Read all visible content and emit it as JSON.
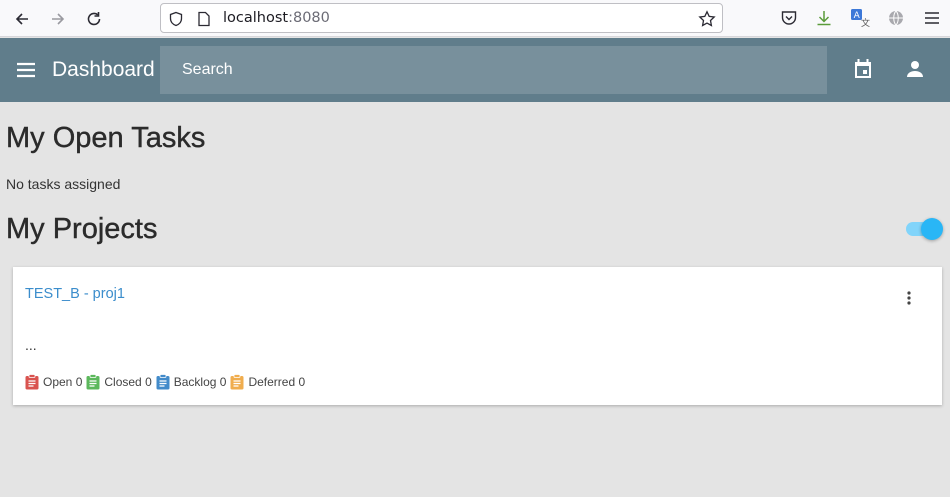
{
  "browser": {
    "url_host": "localhost",
    "url_port": ":8080"
  },
  "app_bar": {
    "title": "Dashboard",
    "search_placeholder": "Search",
    "color": "#607d8b"
  },
  "tasks_section": {
    "heading": "My Open Tasks",
    "empty_text": "No tasks assigned"
  },
  "projects_section": {
    "heading": "My Projects",
    "toggle_on": true,
    "projects": [
      {
        "title": "TEST_B - proj1",
        "description": "...",
        "stats": [
          {
            "label": "Open 0",
            "icon": "clipboard-icon",
            "color": "#d9534f"
          },
          {
            "label": "Closed 0",
            "icon": "clipboard-icon",
            "color": "#5cb85c"
          },
          {
            "label": "Backlog 0",
            "icon": "clipboard-icon",
            "color": "#428bca"
          },
          {
            "label": "Deferred 0",
            "icon": "clipboard-icon",
            "color": "#f0ad4e"
          }
        ]
      }
    ]
  }
}
